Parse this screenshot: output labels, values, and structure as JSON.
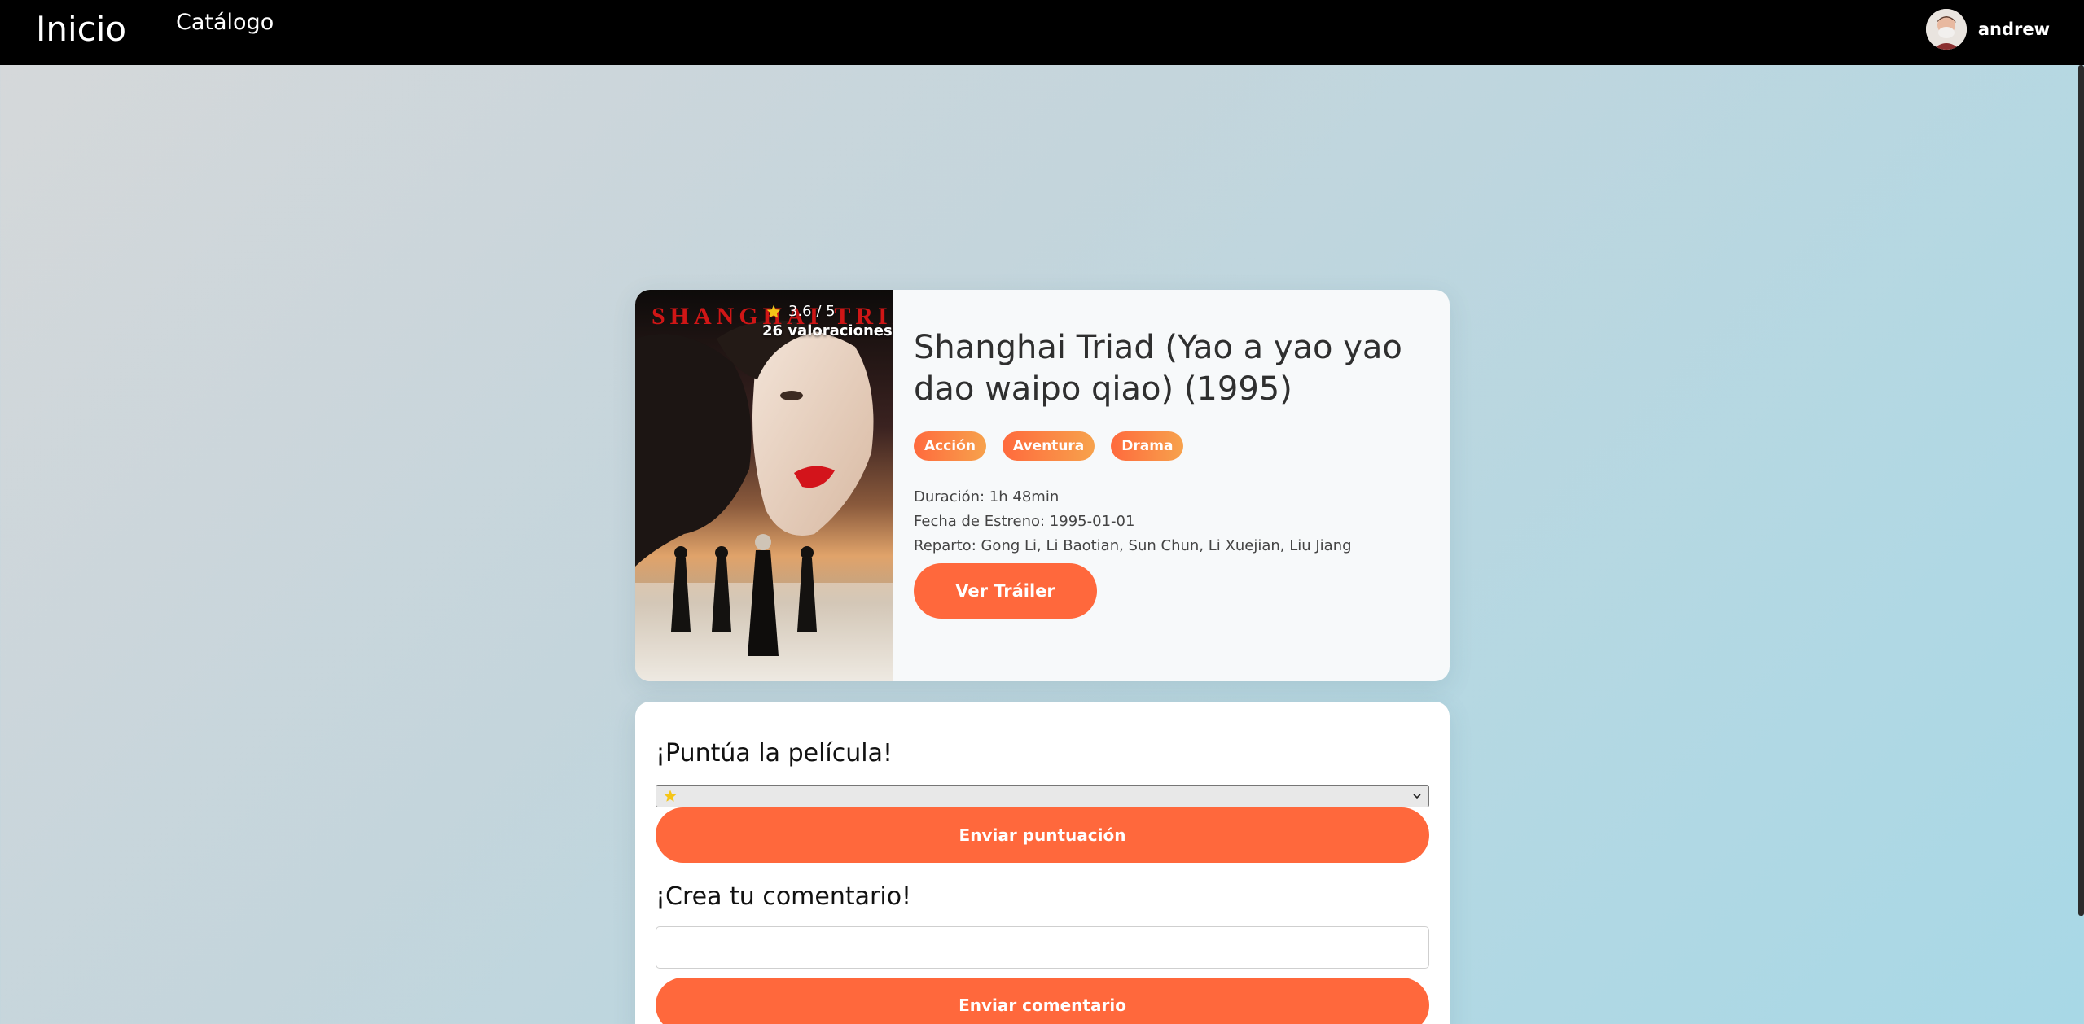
{
  "nav": {
    "brand": "Inicio",
    "links": [
      {
        "label": "Catálogo"
      }
    ],
    "user": {
      "name": "andrew",
      "avatar_icon": "user-avatar"
    }
  },
  "movie": {
    "title": "Shanghai Triad (Yao a yao yao dao waipo qiao) (1995)",
    "poster": {
      "wordmark": "SHANGHAI TRIAD"
    },
    "rating": {
      "score_text": "3.6 / 5",
      "count_text": "26 valoraciones",
      "icon": "star-icon"
    },
    "genres": [
      "Acción",
      "Aventura",
      "Drama"
    ],
    "details": [
      "Duración: 1h 48min",
      "Fecha de Estreno: 1995-01-01",
      "Reparto: Gong Li, Li Baotian, Sun Chun, Li Xuejian, Liu Jiang"
    ],
    "trailer_button": "Ver Tráiler"
  },
  "rate_section": {
    "heading": "¡Puntúa la película!",
    "select_icon": "star-icon",
    "submit_label": "Enviar puntuación"
  },
  "comment_section": {
    "heading": "¡Crea tu comentario!",
    "input_value": "",
    "submit_label": "Enviar comentario"
  },
  "colors": {
    "accent": "#ff683c",
    "tag_gradient_start": "#ff6a3d",
    "tag_gradient_end": "#f7a24c",
    "navbar": "#000000",
    "star": "#f5c518"
  }
}
